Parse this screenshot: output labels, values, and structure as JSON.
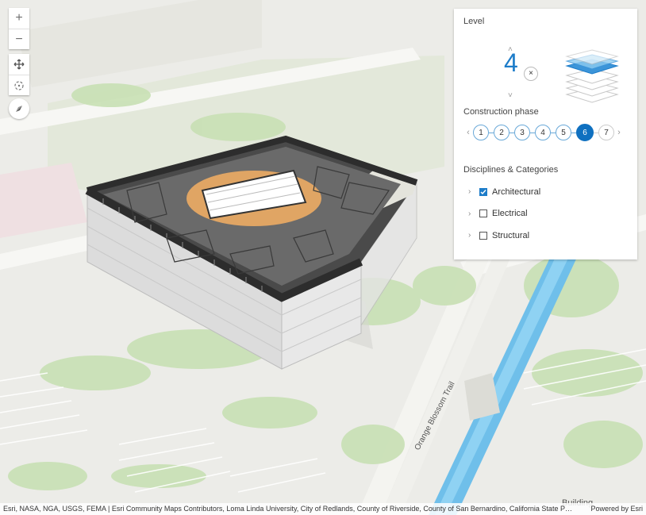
{
  "map": {
    "road_label": "Orange Blossom Trail",
    "building_label": "Building"
  },
  "controls": {
    "zoom_in": "+",
    "zoom_out": "−",
    "pan_icon": "pan-icon",
    "rotate_icon": "rotate-icon",
    "compass_icon": "compass-icon"
  },
  "panel": {
    "level_title": "Level",
    "level_value": "4",
    "level_up": "˄",
    "level_down": "˅",
    "clear_label": "×",
    "phase_title": "Construction phase",
    "phases": [
      "1",
      "2",
      "3",
      "4",
      "5",
      "6",
      "7"
    ],
    "active_phase": "6",
    "prev_label": "‹",
    "next_label": "›",
    "disciplines_title": "Disciplines & Categories",
    "disciplines": [
      {
        "label": "Architectural",
        "checked": true
      },
      {
        "label": "Electrical",
        "checked": false
      },
      {
        "label": "Structural",
        "checked": false
      }
    ]
  },
  "attribution": {
    "text": "Esri, NASA, NGA, USGS, FEMA | Esri Community Maps Contributors, Loma Linda University, City of Redlands, County of Riverside, County of San Bernardino, California State Pa...",
    "powered": "Powered by Esri"
  },
  "colors": {
    "accent": "#0f70c0",
    "water": "#7ec8ee",
    "vegetation": "#c8e0b4"
  }
}
